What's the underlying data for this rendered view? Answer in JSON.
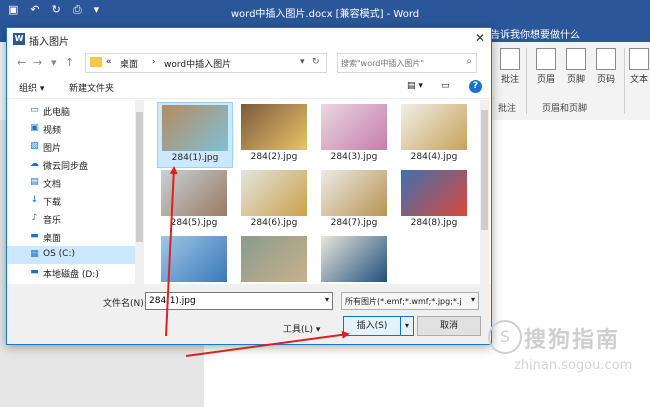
{
  "word": {
    "title": "word中插入图片.docx [兼容模式] - Word",
    "tell_me": "告诉我你想要做什么",
    "ribbon": {
      "comment_label": "批注",
      "comment_group": "批注",
      "header_label": "页眉",
      "footer_label": "页脚",
      "pagenum_label": "页码",
      "hf_group": "页眉和页脚",
      "text_label": "文本"
    }
  },
  "dialog": {
    "title": "插入图片",
    "address": {
      "prefix": "«",
      "crumb1": "桌面",
      "sep": "›",
      "crumb2": "word中插入图片"
    },
    "search_placeholder": "搜索\"word中插入图片\"",
    "toolbar": {
      "organize": "组织 ▾",
      "new_folder": "新建文件夹",
      "help": "?"
    },
    "sidebar": [
      {
        "icon": "computer-icon",
        "glyph": "▭",
        "label": "此电脑",
        "selected": false
      },
      {
        "icon": "video-icon",
        "glyph": "▣",
        "label": "视频",
        "selected": false
      },
      {
        "icon": "picture-icon",
        "glyph": "▨",
        "label": "图片",
        "selected": false
      },
      {
        "icon": "cloud-icon",
        "glyph": "☁",
        "label": "微云同步盘",
        "selected": false
      },
      {
        "icon": "document-icon",
        "glyph": "▤",
        "label": "文档",
        "selected": false
      },
      {
        "icon": "download-icon",
        "glyph": "↓",
        "label": "下载",
        "selected": false
      },
      {
        "icon": "music-icon",
        "glyph": "♪",
        "label": "音乐",
        "selected": false
      },
      {
        "icon": "desktop-icon",
        "glyph": "▬",
        "label": "桌面",
        "selected": false
      },
      {
        "icon": "drive-c-icon",
        "glyph": "▦",
        "label": "OS (C:)",
        "selected": true
      },
      {
        "icon": "drive-d-icon",
        "glyph": "▬",
        "label": "本地磁盘 (D:)",
        "selected": false
      }
    ],
    "files": [
      {
        "name": "284(1).jpg",
        "selected": true,
        "color1": "#b88b5c",
        "color2": "#7ec0d8"
      },
      {
        "name": "284(2).jpg",
        "selected": false,
        "color1": "#7b5a3c",
        "color2": "#e9c46a"
      },
      {
        "name": "284(3).jpg",
        "selected": false,
        "color1": "#e9d7e0",
        "color2": "#c77dab"
      },
      {
        "name": "284(4).jpg",
        "selected": false,
        "color1": "#f1efe8",
        "color2": "#c8a25a"
      },
      {
        "name": "284(5).jpg",
        "selected": false,
        "color1": "#c7d1d8",
        "color2": "#9a7a60"
      },
      {
        "name": "284(6).jpg",
        "selected": false,
        "color1": "#e4e4e0",
        "color2": "#caa24a"
      },
      {
        "name": "284(7).jpg",
        "selected": false,
        "color1": "#ecebe5",
        "color2": "#b89452"
      },
      {
        "name": "284(8).jpg",
        "selected": false,
        "color1": "#3f6fb0",
        "color2": "#d74a3a"
      },
      {
        "name": "",
        "selected": false,
        "color1": "#9fc6e6",
        "color2": "#3a78b8"
      },
      {
        "name": "",
        "selected": false,
        "color1": "#8a9b8f",
        "color2": "#c9b08a"
      },
      {
        "name": "",
        "selected": false,
        "color1": "#e9e6dc",
        "color2": "#1f4f7a"
      }
    ],
    "filename_label": "文件名(N):",
    "filename_value": "284(1).jpg",
    "filetype_value": "所有图片(*.emf;*.wmf;*.jpg;*.j",
    "tools_label": "工具(L)",
    "insert_label": "插入(S)",
    "cancel_label": "取消"
  },
  "watermark": {
    "title": "搜狗指南",
    "url": "zhinan.sogou.com"
  },
  "colors": {
    "word_blue": "#2b579a",
    "arrow_red": "#e02020",
    "select_blue": "#cce8ff"
  }
}
